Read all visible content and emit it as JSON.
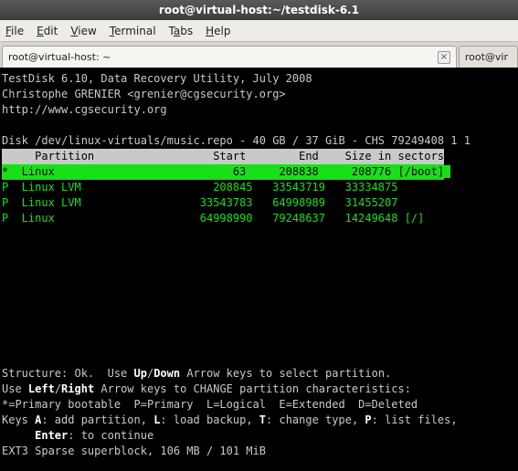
{
  "titlebar": {
    "text": "root@virtual-host:~/testdisk-6.1"
  },
  "menubar": {
    "file": "File",
    "edit": "Edit",
    "view": "View",
    "terminal": "Terminal",
    "tabs": "Tabs",
    "help": "Help"
  },
  "tabs": {
    "active": "root@virtual-host: ~",
    "inactive": "root@vir"
  },
  "term": {
    "line1": "TestDisk 6.10, Data Recovery Utility, July 2008",
    "line2": "Christophe GRENIER <grenier@cgsecurity.org>",
    "line3": "http://www.cgsecurity.org",
    "diskline": "Disk /dev/linux-virtuals/music.repo - 40 GB / 37 GiB - CHS 79249408 1 1",
    "header": "     Partition                  Start        End    Size in sectors",
    "row1": "*  Linux                           63     208838     208776 [/boot]",
    "row2": "P  Linux LVM                    208845   33543719   33334875",
    "row3": "P  Linux LVM                  33543783   64998989   31455207",
    "row4": "P  Linux                      64998990   79248637   14249648 [/]",
    "struct1a": "Structure: Ok.  Use ",
    "struct1b": "Up",
    "struct1c": "/",
    "struct1d": "Down",
    "struct1e": " Arrow keys to select partition.",
    "struct2a": "Use ",
    "struct2b": "Left",
    "struct2c": "/",
    "struct2d": "Right",
    "struct2e": " Arrow keys to CHANGE partition characteristics:",
    "struct3": "*=Primary bootable  P=Primary  L=Logical  E=Extended  D=Deleted",
    "keys_a": "Keys ",
    "keys_A": "A",
    "keys_b": ": add partition, ",
    "keys_L": "L",
    "keys_c": ": load backup, ",
    "keys_T": "T",
    "keys_d": ": change type, ",
    "keys_P": "P",
    "keys_e": ": list files,",
    "enter_a": "     ",
    "enter_b": "Enter",
    "enter_c": ": to continue",
    "fsline": "EXT3 Sparse superblock, 106 MB / 101 MiB"
  }
}
